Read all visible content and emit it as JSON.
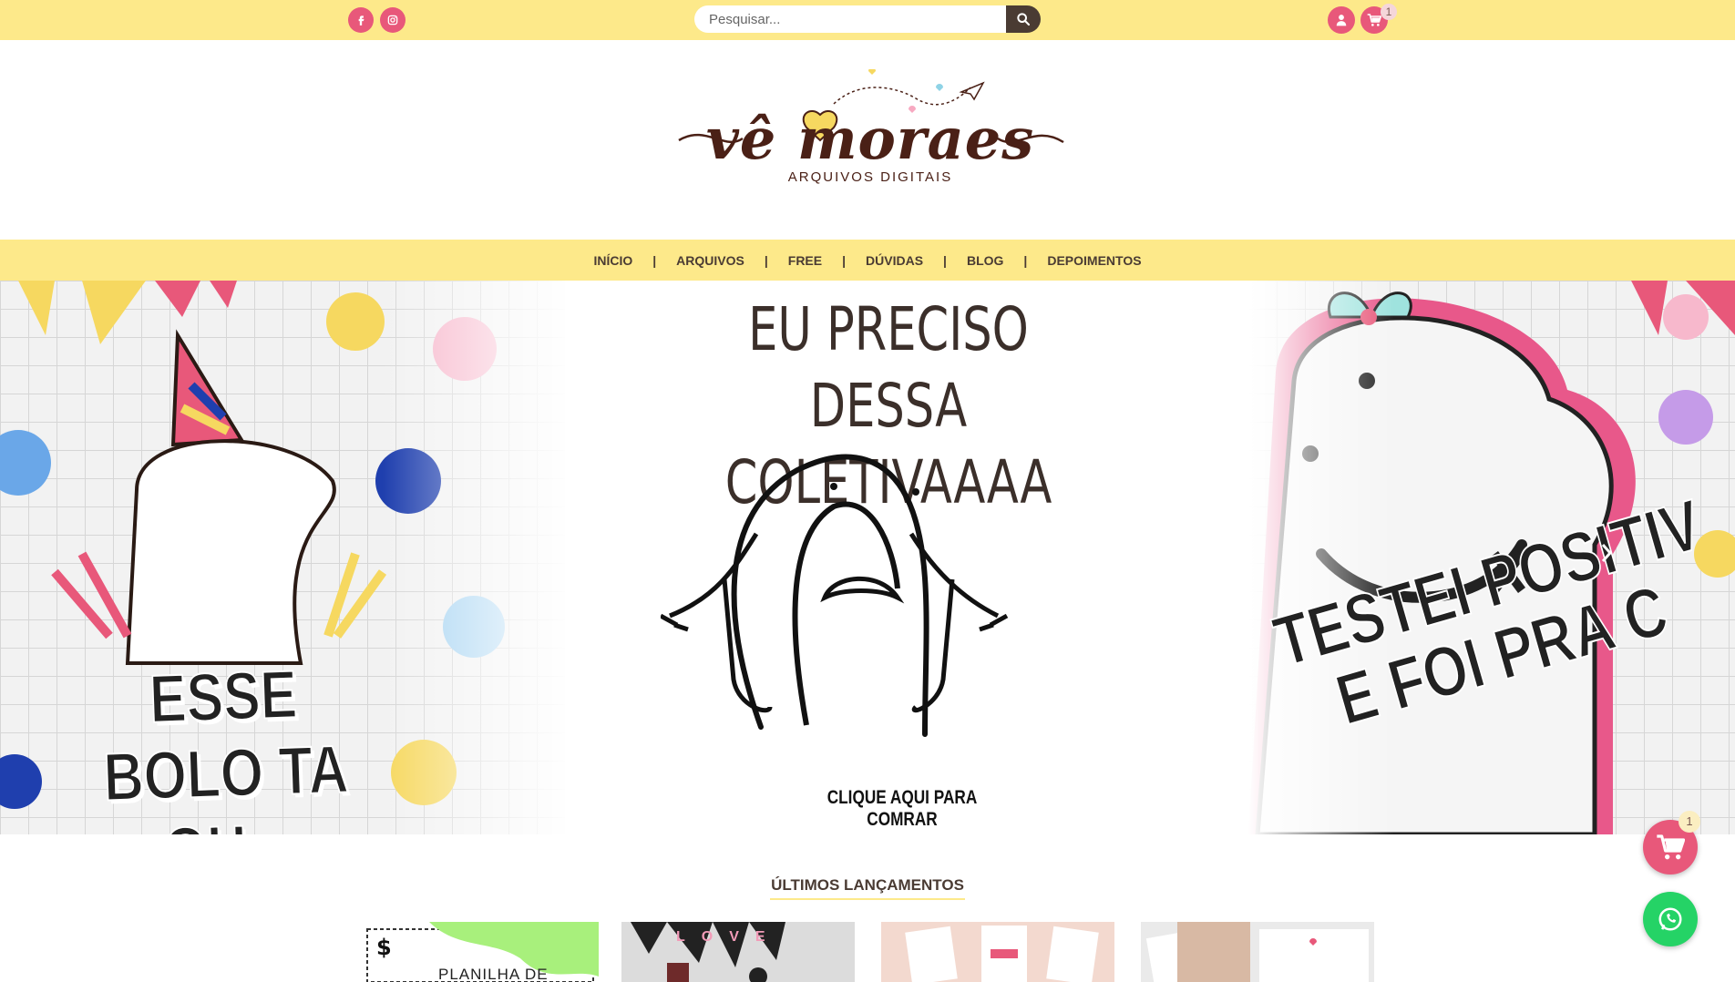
{
  "colors": {
    "topbar_bg": "#fde98a",
    "accent_pink": "#e8587a",
    "dark_brown": "#4a3b33",
    "whatsapp_green": "#25d366"
  },
  "topbar": {
    "social_icons": [
      "facebook-icon",
      "instagram-icon"
    ],
    "search": {
      "placeholder": "Pesquisar...",
      "value": ""
    },
    "cart_count": "1"
  },
  "logo": {
    "name": "vê moraes",
    "tagline": "ARQUIVOS DIGITAIS"
  },
  "nav": {
    "items": [
      "INÍCIO",
      "ARQUIVOS",
      "FREE",
      "DÚVIDAS",
      "BLOG",
      "DEPOIMENTOS"
    ],
    "separator": "|"
  },
  "hero": {
    "left_caption": "ESSE BOLO TA OH...",
    "headline_line1": "EU PRECISO DESSA",
    "headline_line2": "COLETIVAAAA",
    "cta": "CLIQUE AQUI PARA COMRAR",
    "right_caption_line1": "TESTEI POSITIV",
    "right_caption_line2": "E FOI PRA C"
  },
  "latest": {
    "title": "ÚLTIMOS LANÇAMENTOS",
    "product1_text": "PLANILHA DE",
    "product2_text": "LOVE"
  },
  "floating": {
    "cart_count": "1"
  }
}
